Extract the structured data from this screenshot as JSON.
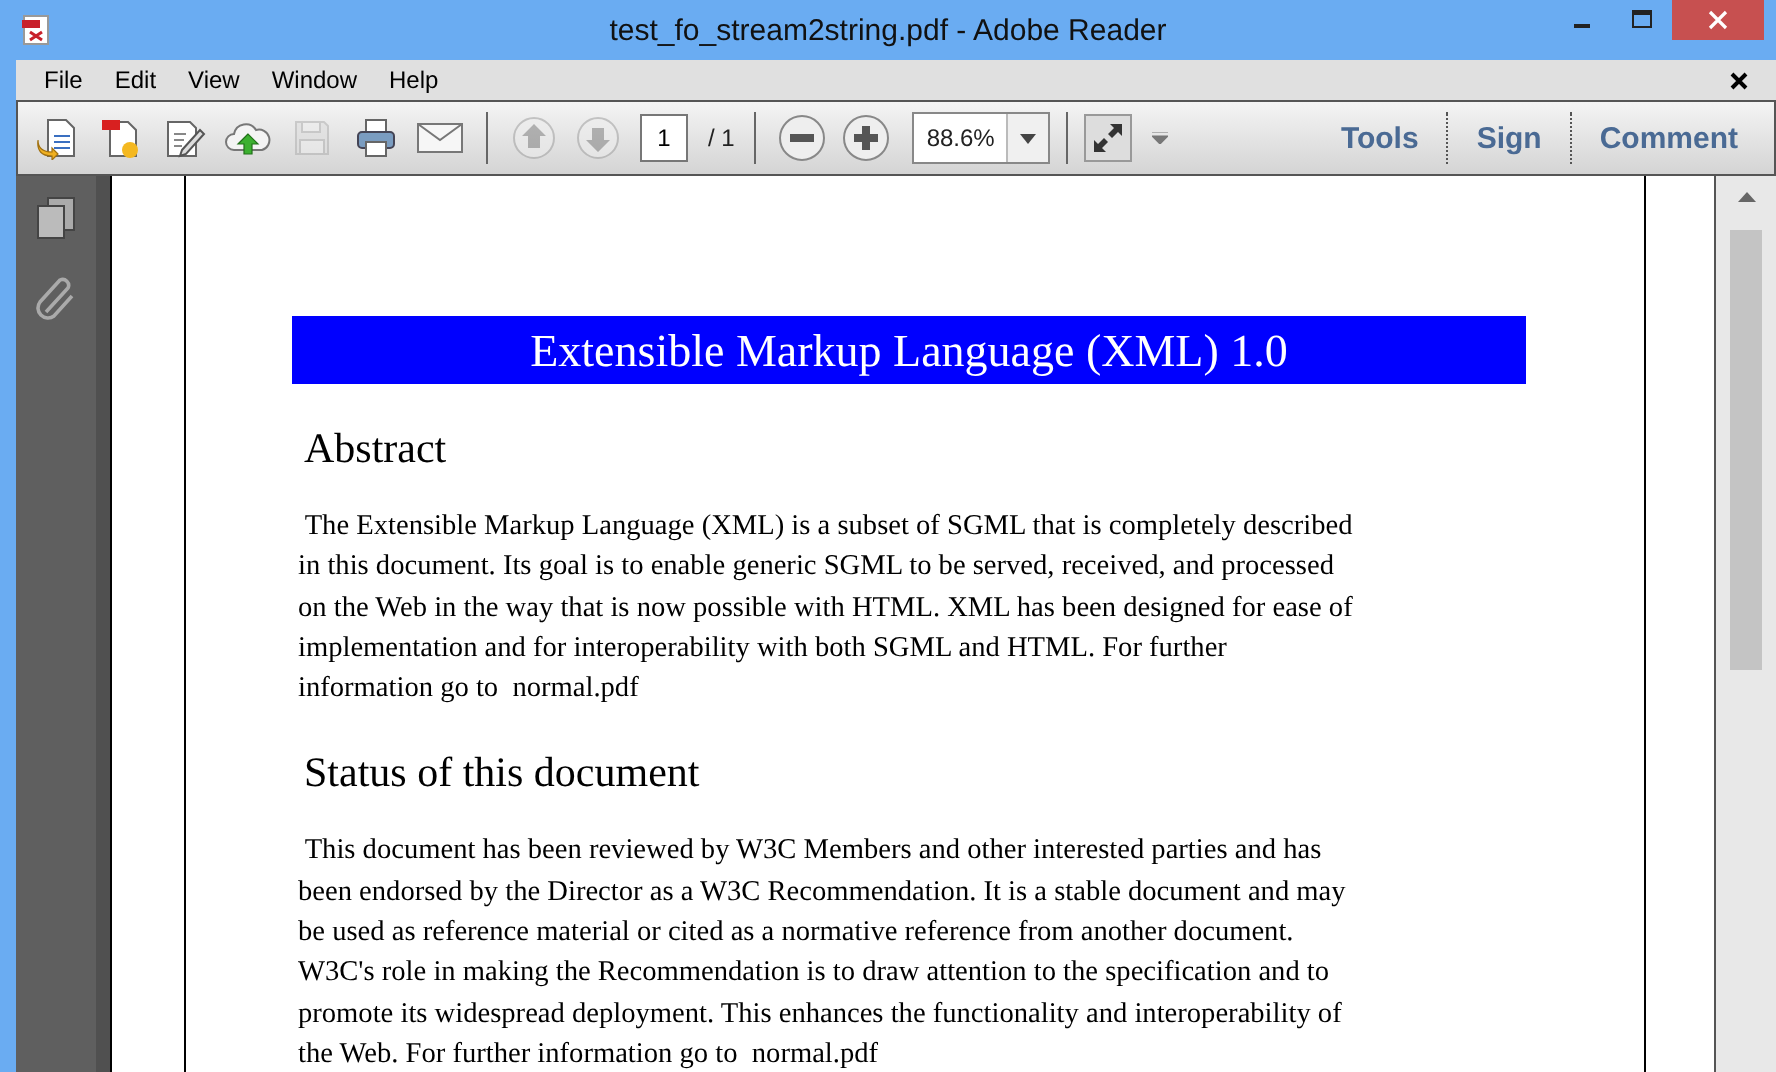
{
  "window": {
    "title": "test_fo_stream2string.pdf - Adobe Reader"
  },
  "menu": [
    "File",
    "Edit",
    "View",
    "Window",
    "Help"
  ],
  "toolbar": {
    "buttons": [
      {
        "kind": "open",
        "disabled": false
      },
      {
        "kind": "create",
        "disabled": false
      },
      {
        "kind": "edit",
        "disabled": false
      },
      {
        "kind": "upload",
        "disabled": false
      },
      {
        "kind": "save",
        "disabled": true
      },
      {
        "kind": "print",
        "disabled": false
      },
      {
        "kind": "mail",
        "disabled": false
      }
    ],
    "nav": [
      {
        "kind": "up",
        "disabled": true
      },
      {
        "kind": "down",
        "disabled": true
      }
    ],
    "page": {
      "value": "1",
      "total": "/ 1"
    },
    "zoom": {
      "value": "88.6%"
    },
    "panels": [
      {
        "label": "Tools"
      },
      {
        "label": "Sign"
      },
      {
        "label": "Comment"
      }
    ]
  },
  "document": {
    "title": "Extensible Markup Language (XML) 1.0",
    "sections": [
      {
        "heading": "Abstract",
        "lines": [
          " The Extensible Markup Language (XML) is a subset of SGML that is completely described",
          "in this document. Its goal is to enable generic SGML to be served, received, and processed",
          "on the Web in the way that is now possible with HTML. XML has been designed for ease of",
          "implementation and for interoperability with both SGML and HTML. For further",
          "information go to  normal.pdf"
        ]
      },
      {
        "heading": "Status of this document",
        "lines": [
          " This document has been reviewed by W3C Members and other interested parties and has",
          "been endorsed by the Director as a W3C Recommendation. It is a stable document and may",
          "be used as reference material or cited as a normative reference from another document.",
          "W3C's role in making the Recommendation is to draw attention to the specification and to",
          "promote its widespread deployment. This enhances the functionality and interoperability of",
          "the Web. For further information go to  normal.pdf"
        ]
      }
    ]
  }
}
